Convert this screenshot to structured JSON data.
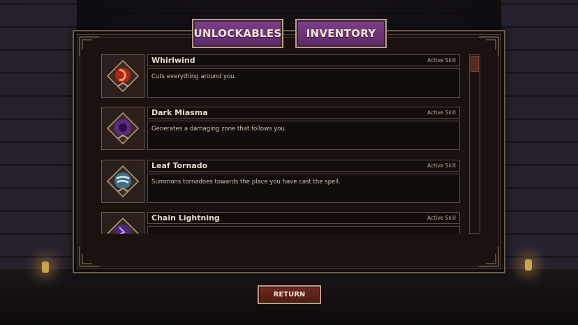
{
  "tabs": {
    "unlockables": "UNLOCKABLES",
    "inventory": "INVENTORY"
  },
  "skills": [
    {
      "name": "Whirlwind",
      "type": "Active Skill",
      "description": "Cuts everything around you.",
      "icon": "whirlwind-icon",
      "color": "#b0241c"
    },
    {
      "name": "Dark Miasma",
      "type": "Active Skill",
      "description": "Generates a damaging zone that follows you.",
      "icon": "dark-miasma-icon",
      "color": "#5c2a86"
    },
    {
      "name": "Leaf Tornado",
      "type": "Active Skill",
      "description": "Summons tornadoes towards the place you have cast the spell.",
      "icon": "leaf-tornado-icon",
      "color": "#3f6f84"
    },
    {
      "name": "Chain Lightning",
      "type": "Active Skill",
      "description": "",
      "icon": "chain-lightning-icon",
      "color": "#4a2a78"
    }
  ],
  "return_label": "RETURN",
  "colors": {
    "tab_purple": "#7f3f8a",
    "button_red": "#6e2a1f",
    "frame_gold": "#b8a07c"
  }
}
